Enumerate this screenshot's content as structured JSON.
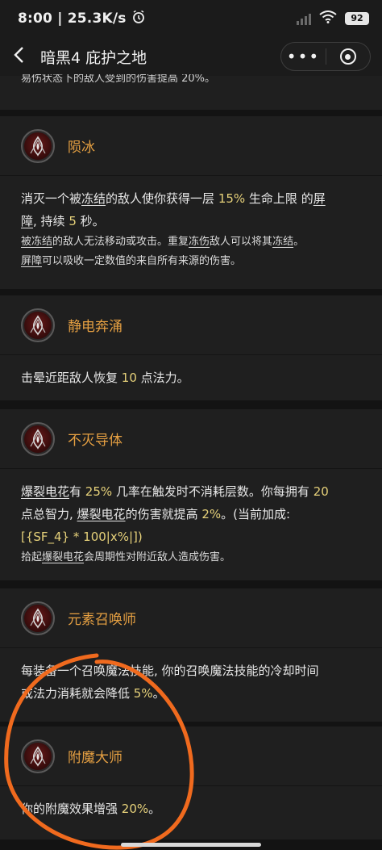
{
  "status": {
    "time": "8:00",
    "speed": "25.3K/s",
    "battery": "92"
  },
  "nav": {
    "title": "暗黑4 庇护之地",
    "more": "•••"
  },
  "top_partial": "易伤状态下的敌人受到的伤害提高 20%。",
  "cards": [
    {
      "name": "陨冰",
      "lines": [
        [
          {
            "t": "消灭一个被"
          },
          {
            "t": "冻结",
            "u": true
          },
          {
            "t": "的敌人使你获得一层 "
          },
          {
            "t": "15%",
            "h": true
          },
          {
            "t": " 生命上限 的"
          },
          {
            "t": "屏",
            "u": true
          }
        ],
        [
          {
            "t": "障",
            "u": true
          },
          {
            "t": ", 持续 "
          },
          {
            "t": "5",
            "h": true
          },
          {
            "t": " 秒。"
          }
        ]
      ],
      "notes": [
        [
          {
            "t": "被冻结",
            "u": true
          },
          {
            "t": "的敌人无法移动或攻击。重复"
          },
          {
            "t": "冻伤",
            "u": true
          },
          {
            "t": "敌人可以将其"
          },
          {
            "t": "冻结",
            "u": true
          },
          {
            "t": "。"
          }
        ],
        [
          {
            "t": "屏障",
            "u": true
          },
          {
            "t": "可以吸收一定数值的来自所有来源的伤害。"
          }
        ]
      ]
    },
    {
      "name": "静电奔涌",
      "lines": [
        [
          {
            "t": "击晕近距敌人恢复 "
          },
          {
            "t": "10",
            "h": true
          },
          {
            "t": " 点法力。"
          }
        ]
      ],
      "notes": []
    },
    {
      "name": "不灭导体",
      "lines": [
        [
          {
            "t": "爆裂电花",
            "u": true
          },
          {
            "t": "有 "
          },
          {
            "t": "25%",
            "h": true
          },
          {
            "t": " 几率在触发时不消耗层数。你每拥有 "
          },
          {
            "t": "20",
            "h": true
          }
        ],
        [
          {
            "t": "点总智力, "
          },
          {
            "t": "爆裂电花",
            "u": true
          },
          {
            "t": "的伤害就提高 "
          },
          {
            "t": "2%",
            "h": true
          },
          {
            "t": "。(当前加成:"
          }
        ],
        [
          {
            "t": "[{SF_4} * 100|x%|])",
            "h": true
          }
        ]
      ],
      "notes": [
        [
          {
            "t": "拾起"
          },
          {
            "t": "爆裂电花",
            "u": true
          },
          {
            "t": "会周期性对附近敌人造成伤害。"
          }
        ]
      ]
    },
    {
      "name": "元素召唤师",
      "lines": [
        [
          {
            "t": "每装备一个召唤魔法技能, 你的召唤魔法技能的冷却时间"
          }
        ],
        [
          {
            "t": "或法力消耗就会降低 "
          },
          {
            "t": "5%",
            "h": true
          },
          {
            "t": "。"
          }
        ]
      ],
      "notes": []
    },
    {
      "name": "附魔大师",
      "lines": [
        [
          {
            "t": "你的附魔效果增强 "
          },
          {
            "t": "20%",
            "h": true
          },
          {
            "t": "。"
          }
        ]
      ],
      "notes": []
    }
  ],
  "colors": {
    "skill_name": "#e6a042",
    "highlight": "#e6d17a",
    "annotation": "#f06a1e"
  }
}
